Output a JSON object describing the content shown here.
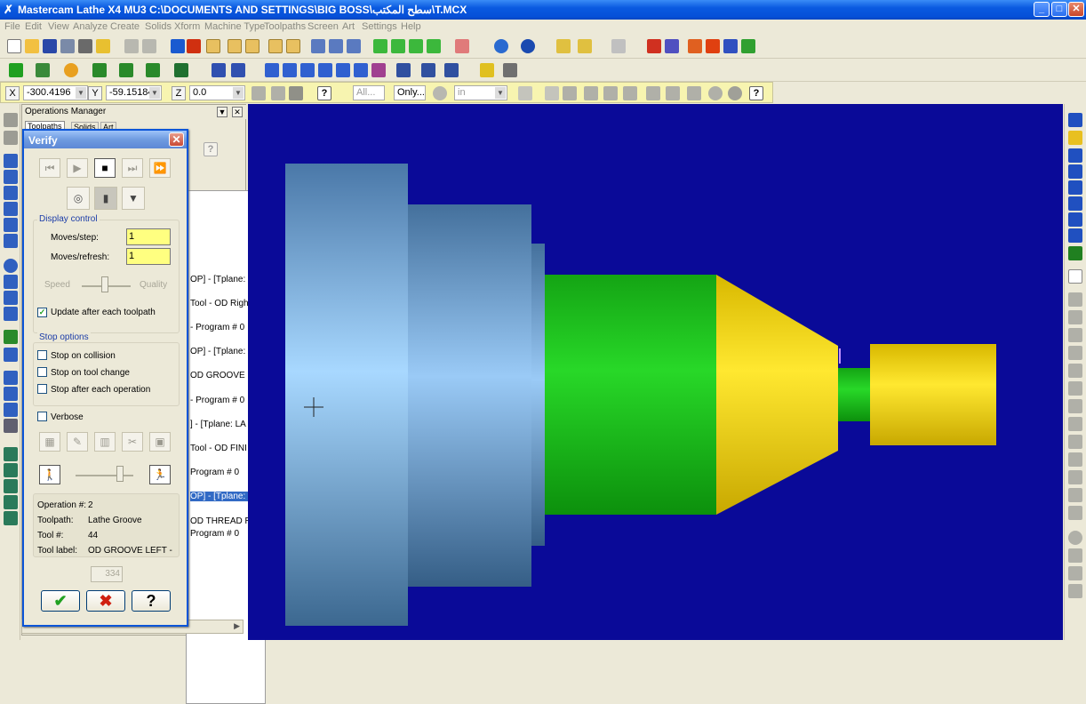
{
  "titlebar": {
    "title": "Mastercam Lathe X4 MU3  C:\\DOCUMENTS AND SETTINGS\\BIG BOSS\\سطح المكتب\\T.MCX",
    "minimize": "_",
    "maximize": "□",
    "close": "✕"
  },
  "menu": [
    "File",
    "Edit",
    "View",
    "Analyze",
    "Create",
    "Solids",
    "Xform",
    "Machine Type",
    "Toolpaths",
    "Screen",
    "Art",
    "Settings",
    "Help"
  ],
  "coords": {
    "x_label": "X",
    "x_value": "-300.4196",
    "y_label": "Y",
    "y_value": "-59.15184",
    "z_label": "Z",
    "z_value": "0.0",
    "all_button": "All...",
    "only_button": "Only...",
    "units": "in"
  },
  "ops_manager": {
    "title": "Operations Manager",
    "tabs": [
      "Toolpaths",
      "Solids",
      "Art"
    ],
    "tree_lines": [
      {
        "text": "OP] - [Tplane: L",
        "selected": false
      },
      {
        "text": "Tool - OD Righ",
        "selected": false
      },
      {
        "text": "- Program # 0",
        "selected": false
      },
      {
        "text": "OP] - [Tplane: I",
        "selected": false
      },
      {
        "text": "OD GROOVE LE",
        "selected": false
      },
      {
        "text": "- Program # 0",
        "selected": false
      },
      {
        "text": "] - [Tplane: LA",
        "selected": false
      },
      {
        "text": "Tool - OD FINI",
        "selected": false
      },
      {
        "text": "Program # 0",
        "selected": false
      },
      {
        "text": "OP] - [Tplane: L",
        "selected": true
      },
      {
        "text": "OD THREAD R",
        "selected": false
      },
      {
        "text": "Program # 0",
        "selected": false
      }
    ]
  },
  "verify": {
    "title": "Verify",
    "display_control_label": "Display control",
    "moves_step_label": "Moves/step:",
    "moves_step_value": "1",
    "moves_refresh_label": "Moves/refresh:",
    "moves_refresh_value": "1",
    "speed_label": "Speed",
    "quality_label": "Quality",
    "update_label": "Update after each toolpath",
    "update_checked": true,
    "stop_options_label": "Stop options",
    "stop_collision": "Stop on collision",
    "stop_tool_change": "Stop on tool change",
    "stop_after_op": "Stop after each operation",
    "verbose": "Verbose",
    "operation_label": "Operation #:",
    "operation_value": "2",
    "toolpath_label": "Toolpath:",
    "toolpath_value": "Lathe Groove",
    "tool_num_label": "Tool #:",
    "tool_num_value": "44",
    "tool_label_label": "Tool label:",
    "tool_label_value": "OD GROOVE LEFT -",
    "counter_value": "334",
    "ok_glyph": "✔",
    "cancel_glyph": "✖",
    "help_glyph": "?"
  },
  "colors": {
    "viewport_bg": "#0a0a98",
    "stock_blue": "#6a9fd0",
    "part_green": "#11c411",
    "part_yellow": "#f0d800",
    "title_blue": "#0a5ae0"
  }
}
